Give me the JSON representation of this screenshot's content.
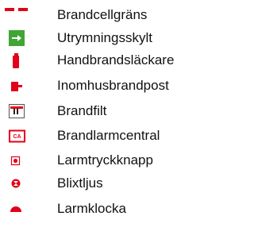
{
  "legend": {
    "items": [
      {
        "icon": "boundary-dashed-line-icon",
        "label": "Brandcellgräns"
      },
      {
        "icon": "exit-sign-icon",
        "label": "Utrymningsskylt"
      },
      {
        "icon": "fire-extinguisher-icon",
        "label": "Handbrandsläckare"
      },
      {
        "icon": "fire-hydrant-icon",
        "label": "Inomhusbrandpost"
      },
      {
        "icon": "fire-blanket-icon",
        "label": "Brandfilt"
      },
      {
        "icon": "fire-alarm-panel-icon",
        "label": "Brandlarmcentral",
        "icon_text": "CA"
      },
      {
        "icon": "alarm-button-icon",
        "label": "Larmtryckknapp"
      },
      {
        "icon": "strobe-light-icon",
        "label": "Blixtljus"
      },
      {
        "icon": "alarm-bell-icon",
        "label": "Larmklocka"
      }
    ]
  },
  "colors": {
    "red": "#e2001a",
    "green": "#3fa535",
    "text": "#111111"
  }
}
